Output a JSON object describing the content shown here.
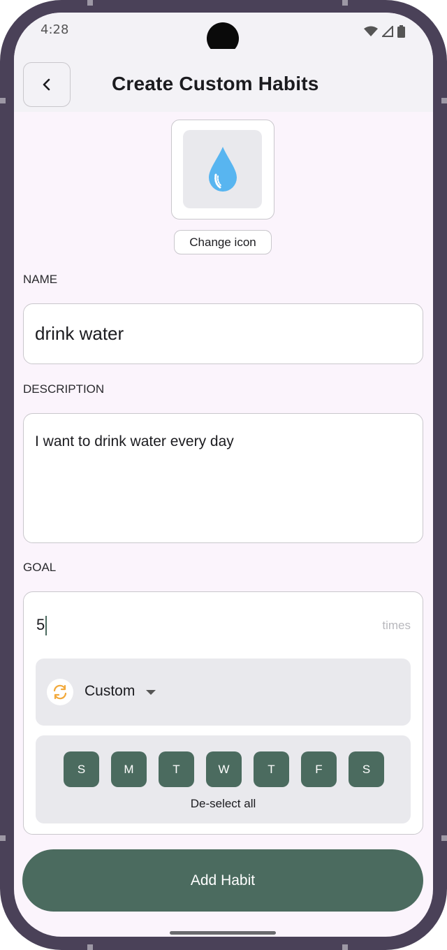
{
  "status": {
    "time": "4:28"
  },
  "header": {
    "title": "Create Custom Habits"
  },
  "icon": {
    "change_label": "Change icon",
    "name": "water-drop-icon",
    "color": "#58b5f0"
  },
  "form": {
    "name_label": "NAME",
    "name_value": "drink water",
    "description_label": "DESCRIPTION",
    "description_value": "I want to drink water every day",
    "goal_label": "GOAL",
    "goal_value": "5",
    "goal_unit": "times"
  },
  "repeat": {
    "label": "Custom",
    "icon": "repeat-icon",
    "icon_color": "#f2a93b"
  },
  "days": {
    "items": [
      "S",
      "M",
      "T",
      "W",
      "T",
      "F",
      "S"
    ],
    "deselect_label": "De-select all"
  },
  "actions": {
    "add_label": "Add Habit"
  },
  "colors": {
    "primary": "#4b6b5f",
    "background": "#fbf4fc",
    "chip_bg": "#e9e9ed"
  }
}
